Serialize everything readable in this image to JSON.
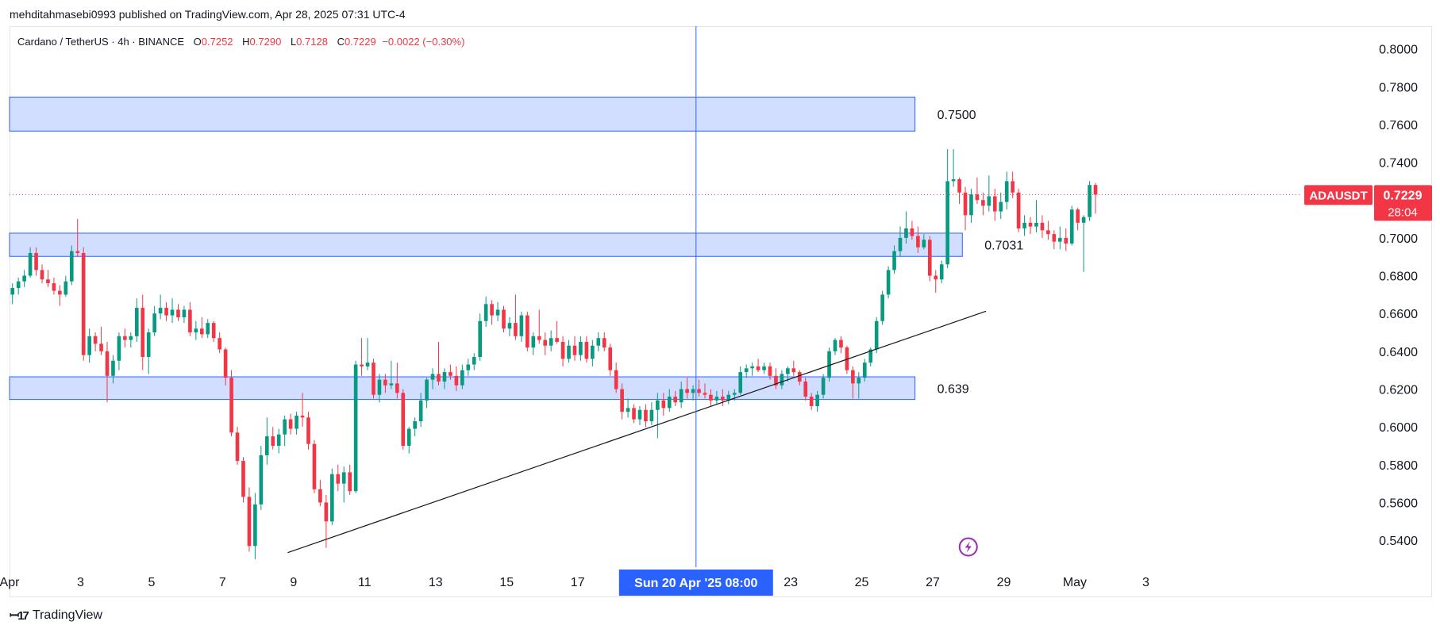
{
  "header": {
    "published_line": "mehditahmasebi0993 published on TradingView.com, Apr 28, 2025 07:31 UTC-4"
  },
  "legend": {
    "symbol": "Cardano / TetherUS · 4h · BINANCE",
    "open_label": "O",
    "open": "0.7252",
    "high_label": "H",
    "high": "0.7290",
    "low_label": "L",
    "low": "0.7128",
    "close_label": "C",
    "close": "0.7229",
    "change": "−0.0022 (−0.30%)"
  },
  "price_tag": {
    "symbol": "ADAUSDT",
    "price": "0.7229",
    "countdown": "28:04"
  },
  "crosshair": {
    "date_label": "Sun 20 Apr '25   08:00"
  },
  "branding": {
    "name": "TradingView"
  },
  "chart_data": {
    "type": "candlestick",
    "interval": "4h",
    "y_axis": {
      "range": [
        0.53,
        0.812
      ],
      "ticks": [
        "0.8000",
        "0.7800",
        "0.7600",
        "0.7400",
        "0.7200",
        "0.7000",
        "0.6800",
        "0.6600",
        "0.6400",
        "0.6200",
        "0.6000",
        "0.5800",
        "0.5600",
        "0.5400"
      ]
    },
    "x_axis": {
      "range": [
        "2025-04-01T00:00",
        "2025-05-04T01:00"
      ],
      "ticks": [
        {
          "t": "2025-04-01T00:00",
          "label": "Apr"
        },
        {
          "t": "2025-04-03T00:00",
          "label": "3"
        },
        {
          "t": "2025-04-05T00:00",
          "label": "5"
        },
        {
          "t": "2025-04-07T00:00",
          "label": "7"
        },
        {
          "t": "2025-04-09T00:00",
          "label": "9"
        },
        {
          "t": "2025-04-11T00:00",
          "label": "11"
        },
        {
          "t": "2025-04-13T00:00",
          "label": "13"
        },
        {
          "t": "2025-04-15T00:00",
          "label": "15"
        },
        {
          "t": "2025-04-17T00:00",
          "label": "17"
        },
        {
          "t": "2025-04-23T00:00",
          "label": "23"
        },
        {
          "t": "2025-04-25T00:00",
          "label": "25"
        },
        {
          "t": "2025-04-27T00:00",
          "label": "27"
        },
        {
          "t": "2025-04-29T00:00",
          "label": "29"
        },
        {
          "t": "2025-05-01T00:00",
          "label": "May"
        },
        {
          "t": "2025-05-03T00:00",
          "label": "3"
        }
      ]
    },
    "grid": false,
    "colors": {
      "up": "#089981",
      "down": "#f23645",
      "zone_fill": "#d0dcff",
      "zone_border": "#2962ff",
      "crosshair": "#2962ff",
      "trendline": "#131722",
      "last_price_line": "#f23645"
    },
    "zones": [
      {
        "label": "0.7500",
        "from": "2025-04-01T00:00",
        "to": "2025-04-26T12:00",
        "low": 0.7565,
        "high": 0.7745
      },
      {
        "label": "0.7031",
        "from": "2025-04-01T00:00",
        "to": "2025-04-27T20:00",
        "low": 0.6902,
        "high": 0.7025
      },
      {
        "label": "0.639",
        "from": "2025-04-01T00:00",
        "to": "2025-04-26T12:00",
        "low": 0.6145,
        "high": 0.6265
      }
    ],
    "trendline": {
      "from": {
        "t": "2025-04-08T20:00",
        "p": 0.5335
      },
      "to": {
        "t": "2025-04-28T12:00",
        "p": 0.6612
      }
    },
    "crosshair_time": "2025-04-20T08:00",
    "last_price": 0.7229,
    "candles_start": "2025-04-01T00:00",
    "candles_ohlc": [
      [
        0.67,
        0.676,
        0.665,
        0.6735
      ],
      [
        0.6735,
        0.679,
        0.67,
        0.677
      ],
      [
        0.677,
        0.683,
        0.674,
        0.68
      ],
      [
        0.68,
        0.695,
        0.679,
        0.692
      ],
      [
        0.692,
        0.695,
        0.68,
        0.683
      ],
      [
        0.683,
        0.686,
        0.676,
        0.678
      ],
      [
        0.678,
        0.683,
        0.674,
        0.676
      ],
      [
        0.676,
        0.679,
        0.67,
        0.672
      ],
      [
        0.672,
        0.675,
        0.664,
        0.67
      ],
      [
        0.67,
        0.68,
        0.669,
        0.677
      ],
      [
        0.677,
        0.696,
        0.675,
        0.693
      ],
      [
        0.693,
        0.71,
        0.69,
        0.692
      ],
      [
        0.692,
        0.695,
        0.635,
        0.638
      ],
      [
        0.638,
        0.652,
        0.634,
        0.648
      ],
      [
        0.648,
        0.65,
        0.64,
        0.644
      ],
      [
        0.644,
        0.653,
        0.638,
        0.64
      ],
      [
        0.64,
        0.645,
        0.613,
        0.627
      ],
      [
        0.627,
        0.638,
        0.623,
        0.635
      ],
      [
        0.635,
        0.65,
        0.63,
        0.648
      ],
      [
        0.648,
        0.652,
        0.642,
        0.646
      ],
      [
        0.646,
        0.65,
        0.642,
        0.648
      ],
      [
        0.648,
        0.668,
        0.645,
        0.663
      ],
      [
        0.663,
        0.67,
        0.63,
        0.637
      ],
      [
        0.637,
        0.652,
        0.628,
        0.65
      ],
      [
        0.65,
        0.664,
        0.648,
        0.66
      ],
      [
        0.66,
        0.67,
        0.657,
        0.663
      ],
      [
        0.663,
        0.666,
        0.656,
        0.659
      ],
      [
        0.659,
        0.668,
        0.655,
        0.662
      ],
      [
        0.662,
        0.665,
        0.656,
        0.658
      ],
      [
        0.658,
        0.664,
        0.655,
        0.662
      ],
      [
        0.662,
        0.666,
        0.648,
        0.65
      ],
      [
        0.65,
        0.656,
        0.646,
        0.652
      ],
      [
        0.652,
        0.658,
        0.647,
        0.649
      ],
      [
        0.649,
        0.657,
        0.647,
        0.655
      ],
      [
        0.655,
        0.656,
        0.645,
        0.647
      ],
      [
        0.647,
        0.65,
        0.639,
        0.641
      ],
      [
        0.641,
        0.642,
        0.622,
        0.626
      ],
      [
        0.626,
        0.63,
        0.595,
        0.597
      ],
      [
        0.597,
        0.6,
        0.58,
        0.582
      ],
      [
        0.582,
        0.584,
        0.56,
        0.563
      ],
      [
        0.563,
        0.568,
        0.534,
        0.537
      ],
      [
        0.537,
        0.565,
        0.53,
        0.559
      ],
      [
        0.559,
        0.59,
        0.556,
        0.585
      ],
      [
        0.585,
        0.605,
        0.58,
        0.595
      ],
      [
        0.595,
        0.6,
        0.588,
        0.59
      ],
      [
        0.59,
        0.599,
        0.586,
        0.596
      ],
      [
        0.596,
        0.606,
        0.59,
        0.604
      ],
      [
        0.604,
        0.607,
        0.596,
        0.599
      ],
      [
        0.599,
        0.608,
        0.596,
        0.606
      ],
      [
        0.606,
        0.618,
        0.6,
        0.605
      ],
      [
        0.605,
        0.608,
        0.588,
        0.591
      ],
      [
        0.591,
        0.593,
        0.565,
        0.567
      ],
      [
        0.567,
        0.572,
        0.558,
        0.56
      ],
      [
        0.56,
        0.564,
        0.536,
        0.55
      ],
      [
        0.55,
        0.578,
        0.548,
        0.575
      ],
      [
        0.575,
        0.58,
        0.566,
        0.57
      ],
      [
        0.57,
        0.579,
        0.56,
        0.576
      ],
      [
        0.576,
        0.58,
        0.564,
        0.566
      ],
      [
        0.566,
        0.635,
        0.565,
        0.633
      ],
      [
        0.633,
        0.647,
        0.627,
        0.632
      ],
      [
        0.632,
        0.647,
        0.63,
        0.634
      ],
      [
        0.634,
        0.636,
        0.615,
        0.617
      ],
      [
        0.617,
        0.628,
        0.613,
        0.625
      ],
      [
        0.625,
        0.628,
        0.618,
        0.622
      ],
      [
        0.622,
        0.635,
        0.62,
        0.623
      ],
      [
        0.623,
        0.634,
        0.615,
        0.618
      ],
      [
        0.618,
        0.62,
        0.588,
        0.59
      ],
      [
        0.59,
        0.6,
        0.586,
        0.599
      ],
      [
        0.599,
        0.605,
        0.595,
        0.603
      ],
      [
        0.603,
        0.618,
        0.6,
        0.614
      ],
      [
        0.614,
        0.626,
        0.61,
        0.625
      ],
      [
        0.625,
        0.631,
        0.62,
        0.628
      ],
      [
        0.628,
        0.645,
        0.622,
        0.624
      ],
      [
        0.624,
        0.631,
        0.62,
        0.629
      ],
      [
        0.629,
        0.633,
        0.625,
        0.627
      ],
      [
        0.627,
        0.632,
        0.619,
        0.622
      ],
      [
        0.622,
        0.633,
        0.62,
        0.63
      ],
      [
        0.63,
        0.636,
        0.627,
        0.633
      ],
      [
        0.633,
        0.639,
        0.63,
        0.637
      ],
      [
        0.637,
        0.66,
        0.635,
        0.656
      ],
      [
        0.656,
        0.669,
        0.653,
        0.665
      ],
      [
        0.665,
        0.667,
        0.654,
        0.659
      ],
      [
        0.659,
        0.666,
        0.656,
        0.662
      ],
      [
        0.662,
        0.664,
        0.65,
        0.652
      ],
      [
        0.652,
        0.658,
        0.648,
        0.655
      ],
      [
        0.655,
        0.67,
        0.646,
        0.648
      ],
      [
        0.648,
        0.661,
        0.645,
        0.659
      ],
      [
        0.659,
        0.661,
        0.64,
        0.642
      ],
      [
        0.642,
        0.65,
        0.638,
        0.648
      ],
      [
        0.648,
        0.662,
        0.644,
        0.646
      ],
      [
        0.646,
        0.65,
        0.638,
        0.643
      ],
      [
        0.643,
        0.651,
        0.64,
        0.647
      ],
      [
        0.647,
        0.656,
        0.644,
        0.645
      ],
      [
        0.645,
        0.648,
        0.632,
        0.636
      ],
      [
        0.636,
        0.646,
        0.634,
        0.643
      ],
      [
        0.643,
        0.648,
        0.635,
        0.638
      ],
      [
        0.638,
        0.648,
        0.635,
        0.645
      ],
      [
        0.645,
        0.648,
        0.634,
        0.636
      ],
      [
        0.636,
        0.646,
        0.632,
        0.643
      ],
      [
        0.643,
        0.65,
        0.64,
        0.647
      ],
      [
        0.647,
        0.65,
        0.64,
        0.642
      ],
      [
        0.642,
        0.644,
        0.627,
        0.63
      ],
      [
        0.63,
        0.634,
        0.618,
        0.62
      ],
      [
        0.62,
        0.623,
        0.604,
        0.608
      ],
      [
        0.608,
        0.615,
        0.605,
        0.61
      ],
      [
        0.61,
        0.612,
        0.602,
        0.604
      ],
      [
        0.604,
        0.611,
        0.601,
        0.609
      ],
      [
        0.609,
        0.612,
        0.6,
        0.603
      ],
      [
        0.603,
        0.613,
        0.601,
        0.609
      ],
      [
        0.609,
        0.618,
        0.594,
        0.614
      ],
      [
        0.614,
        0.618,
        0.606,
        0.61
      ],
      [
        0.61,
        0.62,
        0.608,
        0.616
      ],
      [
        0.616,
        0.619,
        0.611,
        0.613
      ],
      [
        0.613,
        0.624,
        0.61,
        0.62
      ],
      [
        0.62,
        0.626,
        0.615,
        0.618
      ],
      [
        0.618,
        0.622,
        0.614,
        0.62
      ],
      [
        0.62,
        0.625,
        0.616,
        0.618
      ],
      [
        0.618,
        0.623,
        0.615,
        0.617
      ],
      [
        0.617,
        0.62,
        0.611,
        0.614
      ],
      [
        0.614,
        0.619,
        0.612,
        0.616
      ],
      [
        0.616,
        0.62,
        0.611,
        0.614
      ],
      [
        0.614,
        0.619,
        0.612,
        0.617
      ],
      [
        0.617,
        0.62,
        0.614,
        0.618
      ],
      [
        0.618,
        0.632,
        0.617,
        0.629
      ],
      [
        0.629,
        0.633,
        0.626,
        0.631
      ],
      [
        0.631,
        0.634,
        0.627,
        0.632
      ],
      [
        0.632,
        0.636,
        0.629,
        0.63
      ],
      [
        0.63,
        0.634,
        0.628,
        0.632
      ],
      [
        0.632,
        0.634,
        0.625,
        0.627
      ],
      [
        0.627,
        0.631,
        0.62,
        0.622
      ],
      [
        0.622,
        0.63,
        0.62,
        0.628
      ],
      [
        0.628,
        0.632,
        0.624,
        0.631
      ],
      [
        0.631,
        0.635,
        0.627,
        0.629
      ],
      [
        0.629,
        0.63,
        0.622,
        0.624
      ],
      [
        0.624,
        0.626,
        0.614,
        0.616
      ],
      [
        0.616,
        0.618,
        0.609,
        0.611
      ],
      [
        0.611,
        0.619,
        0.608,
        0.617
      ],
      [
        0.617,
        0.628,
        0.615,
        0.626
      ],
      [
        0.626,
        0.642,
        0.624,
        0.64
      ],
      [
        0.64,
        0.647,
        0.638,
        0.646
      ],
      [
        0.646,
        0.648,
        0.639,
        0.642
      ],
      [
        0.642,
        0.643,
        0.628,
        0.63
      ],
      [
        0.63,
        0.632,
        0.615,
        0.623
      ],
      [
        0.623,
        0.629,
        0.615,
        0.626
      ],
      [
        0.626,
        0.636,
        0.624,
        0.634
      ],
      [
        0.634,
        0.642,
        0.632,
        0.641
      ],
      [
        0.641,
        0.658,
        0.639,
        0.656
      ],
      [
        0.656,
        0.672,
        0.654,
        0.67
      ],
      [
        0.67,
        0.685,
        0.668,
        0.683
      ],
      [
        0.683,
        0.696,
        0.681,
        0.693
      ],
      [
        0.693,
        0.706,
        0.69,
        0.7
      ],
      [
        0.7,
        0.714,
        0.697,
        0.705
      ],
      [
        0.705,
        0.709,
        0.699,
        0.701
      ],
      [
        0.701,
        0.706,
        0.692,
        0.695
      ],
      [
        0.695,
        0.702,
        0.694,
        0.699
      ],
      [
        0.699,
        0.701,
        0.677,
        0.68
      ],
      [
        0.68,
        0.683,
        0.671,
        0.678
      ],
      [
        0.678,
        0.688,
        0.676,
        0.686
      ],
      [
        0.686,
        0.747,
        0.684,
        0.73
      ],
      [
        0.73,
        0.747,
        0.727,
        0.731
      ],
      [
        0.731,
        0.732,
        0.718,
        0.724
      ],
      [
        0.724,
        0.727,
        0.704,
        0.712
      ],
      [
        0.712,
        0.726,
        0.708,
        0.723
      ],
      [
        0.723,
        0.732,
        0.718,
        0.72
      ],
      [
        0.72,
        0.724,
        0.712,
        0.717
      ],
      [
        0.717,
        0.733,
        0.714,
        0.722
      ],
      [
        0.722,
        0.726,
        0.709,
        0.714
      ],
      [
        0.714,
        0.724,
        0.71,
        0.719
      ],
      [
        0.719,
        0.735,
        0.715,
        0.73
      ],
      [
        0.73,
        0.735,
        0.721,
        0.724
      ],
      [
        0.724,
        0.726,
        0.703,
        0.705
      ],
      [
        0.705,
        0.712,
        0.701,
        0.708
      ],
      [
        0.708,
        0.711,
        0.702,
        0.706
      ],
      [
        0.706,
        0.72,
        0.703,
        0.708
      ],
      [
        0.708,
        0.712,
        0.7,
        0.704
      ],
      [
        0.704,
        0.709,
        0.699,
        0.702
      ],
      [
        0.702,
        0.704,
        0.694,
        0.698
      ],
      [
        0.698,
        0.706,
        0.694,
        0.7
      ],
      [
        0.7,
        0.705,
        0.693,
        0.697
      ],
      [
        0.697,
        0.717,
        0.696,
        0.715
      ],
      [
        0.715,
        0.716,
        0.704,
        0.708
      ],
      [
        0.708,
        0.712,
        0.682,
        0.711
      ],
      [
        0.711,
        0.73,
        0.709,
        0.728
      ],
      [
        0.728,
        0.729,
        0.7128,
        0.7229
      ]
    ]
  }
}
